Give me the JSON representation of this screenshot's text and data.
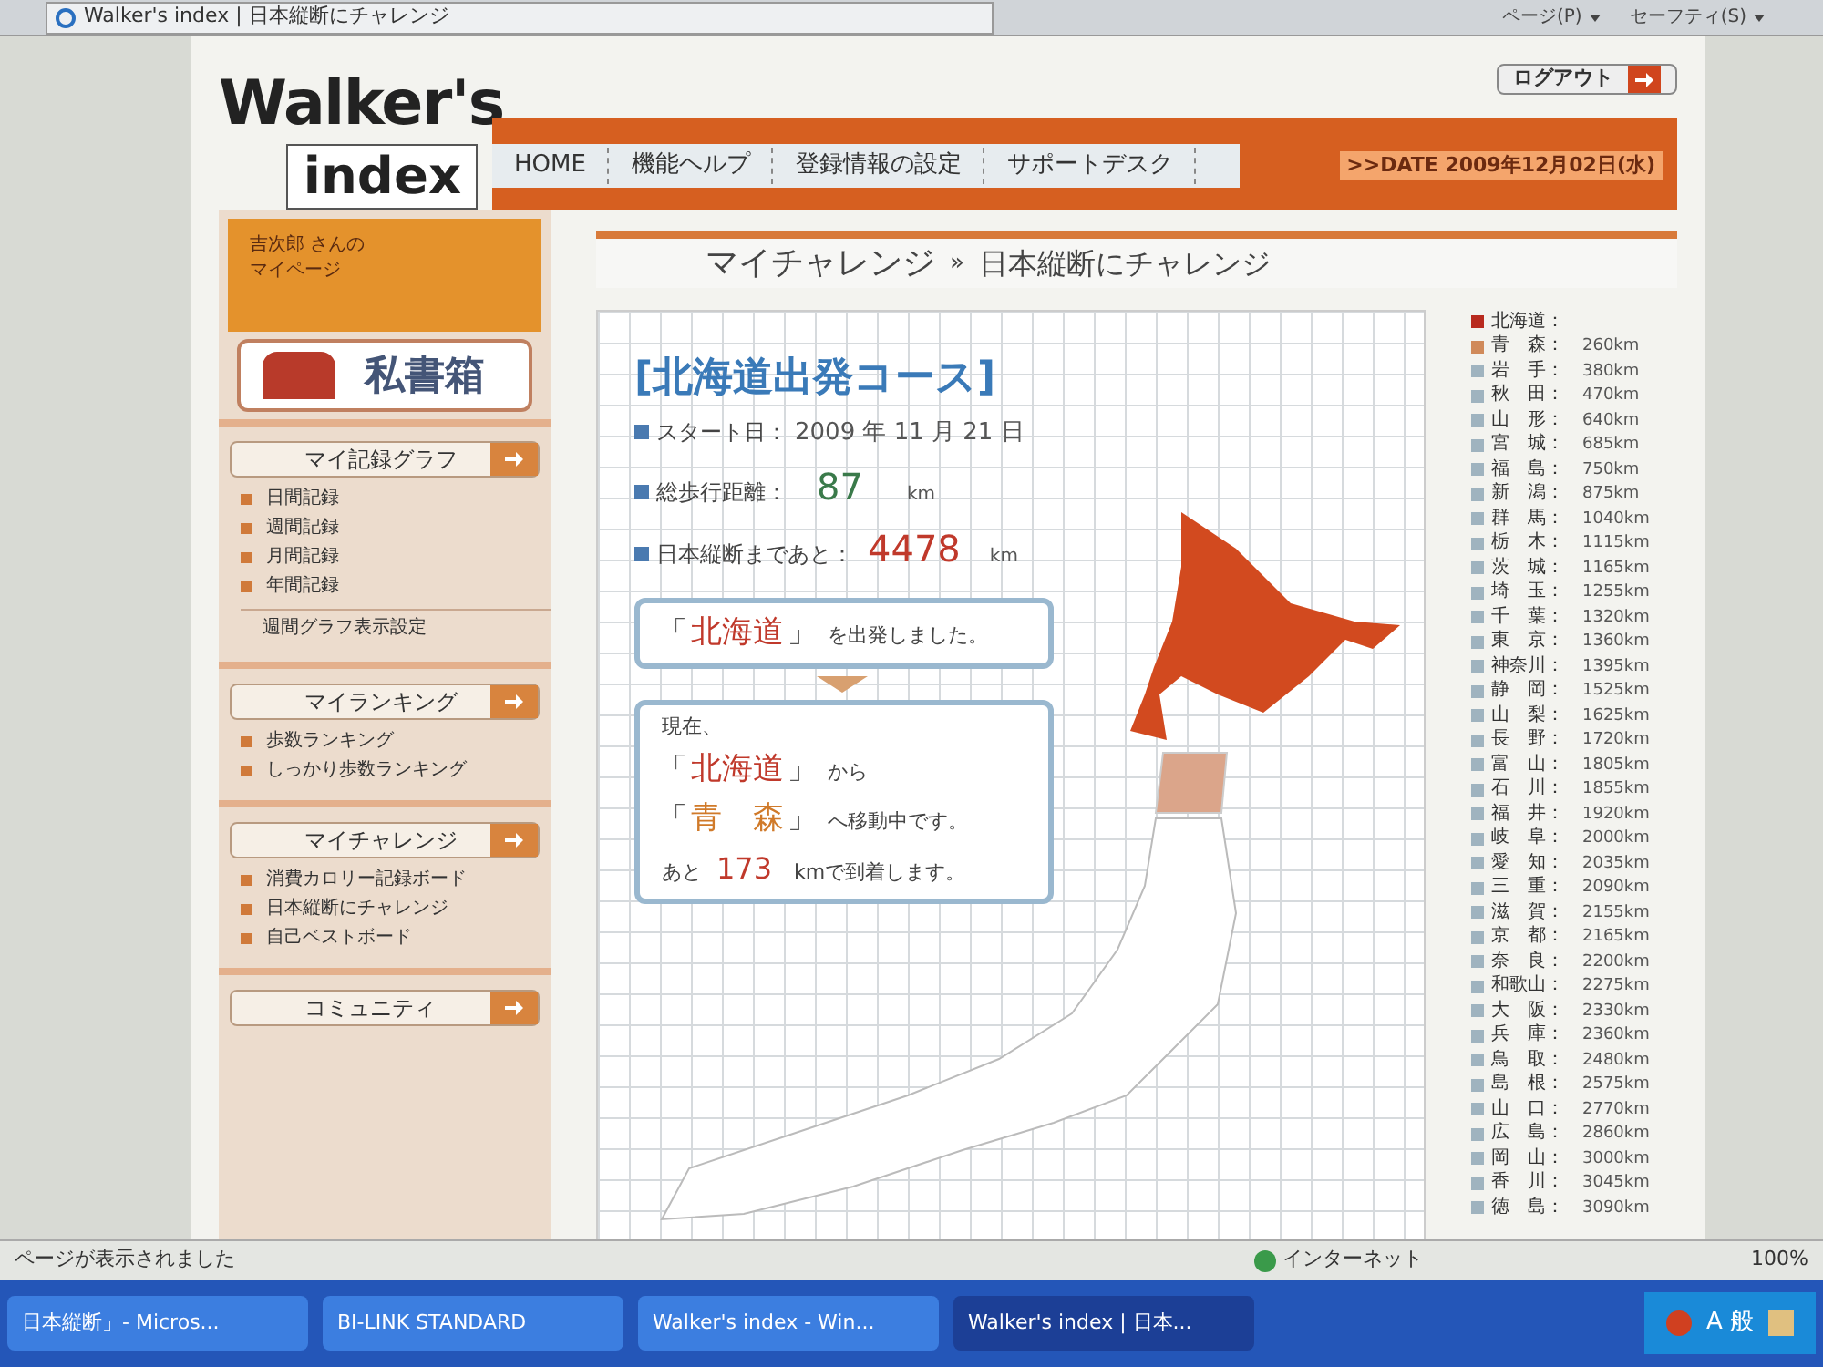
{
  "browser": {
    "tab_title": "Walker's index | 日本縦断にチャレンジ",
    "toolbar": [
      "ページ(P)",
      "セーフティ(S)"
    ]
  },
  "header": {
    "logo_top": "Walker's",
    "logo_bottom": "index",
    "logout": "ログアウト",
    "nav": [
      "HOME",
      "機能ヘルプ",
      "登録情報の設定",
      "サポートデスク"
    ],
    "date": ">>DATE 2009年12月02日(水)"
  },
  "sidebar": {
    "user_lines": [
      "吉次郎 さんの",
      "マイページ"
    ],
    "mailbox": "私書箱",
    "sections": [
      {
        "title": "マイ記録グラフ",
        "items": [
          {
            "kind": "bullet",
            "label": "日間記録"
          },
          {
            "kind": "bullet",
            "label": "週間記録"
          },
          {
            "kind": "bullet",
            "label": "月間記録"
          },
          {
            "kind": "bullet",
            "label": "年間記録"
          },
          {
            "kind": "plain",
            "label": "週間グラフ表示設定"
          }
        ]
      },
      {
        "title": "マイランキング",
        "items": [
          {
            "kind": "bullet",
            "label": "歩数ランキング"
          },
          {
            "kind": "bullet",
            "label": "しっかり歩数ランキング"
          }
        ]
      },
      {
        "title": "マイチャレンジ",
        "items": [
          {
            "kind": "bullet",
            "label": "消費カロリー記録ボード"
          },
          {
            "kind": "bullet",
            "label": "日本縦断にチャレンジ"
          },
          {
            "kind": "bullet",
            "label": "自己ベストボード"
          }
        ]
      },
      {
        "title": "コミュニティ"
      }
    ]
  },
  "breadcrumb": {
    "parent": "マイチャレンジ",
    "separator": "»",
    "current": "日本縦断にチャレンジ"
  },
  "course": {
    "title": "[北海道出発コース]",
    "stats": [
      {
        "label": "スタート日：",
        "value": "2009 年 11 月 21 日",
        "kind": "date"
      },
      {
        "label": "総歩行距離：",
        "value": "87",
        "unit": "km",
        "kind": "walked"
      },
      {
        "label": "日本縦断まであと：",
        "value": "4478",
        "unit": "km",
        "kind": "remaining"
      }
    ],
    "departed_box": [
      [
        {
          "kind": "bracket",
          "text": "「"
        },
        {
          "kind": "place",
          "text": "北海道",
          "color": "#c0392b"
        },
        {
          "kind": "bracket",
          "text": "」"
        },
        {
          "kind": "text",
          "text": "を出発しました。"
        }
      ]
    ],
    "current_box": [
      [
        {
          "kind": "text",
          "text": "現在、"
        }
      ],
      [
        {
          "kind": "bracket",
          "text": "「"
        },
        {
          "kind": "place",
          "text": "北海道",
          "color": "#c0392b"
        },
        {
          "kind": "bracket",
          "text": "」"
        },
        {
          "kind": "text",
          "text": "から"
        }
      ],
      [
        {
          "kind": "bracket",
          "text": "「"
        },
        {
          "kind": "place",
          "text": "青　森",
          "color": "#d07a2a"
        },
        {
          "kind": "bracket",
          "text": "」"
        },
        {
          "kind": "text",
          "text": "へ移動中です。"
        }
      ],
      [
        {
          "kind": "text",
          "text": "あと"
        },
        {
          "kind": "number",
          "text": "173"
        },
        {
          "kind": "text",
          "text": "kmで到着します。"
        }
      ]
    ]
  },
  "legend": [
    {
      "name": "北海道：",
      "color": "#b82a1e"
    },
    {
      "name": "青　森：",
      "distance": "260km",
      "color": "#d08a5a"
    },
    {
      "name": "岩　手：",
      "distance": "380km",
      "color": "#9fb3bf"
    },
    {
      "name": "秋　田：",
      "distance": "470km",
      "color": "#9fb3bf"
    },
    {
      "name": "山　形：",
      "distance": "640km",
      "color": "#9fb3bf"
    },
    {
      "name": "宮　城：",
      "distance": "685km",
      "color": "#9fb3bf"
    },
    {
      "name": "福　島：",
      "distance": "750km",
      "color": "#9fb3bf"
    },
    {
      "name": "新　潟：",
      "distance": "875km",
      "color": "#9fb3bf"
    },
    {
      "name": "群　馬：",
      "distance": "1040km",
      "color": "#9fb3bf"
    },
    {
      "name": "栃　木：",
      "distance": "1115km",
      "color": "#9fb3bf"
    },
    {
      "name": "茨　城：",
      "distance": "1165km",
      "color": "#9fb3bf"
    },
    {
      "name": "埼　玉：",
      "distance": "1255km",
      "color": "#9fb3bf"
    },
    {
      "name": "千　葉：",
      "distance": "1320km",
      "color": "#9fb3bf"
    },
    {
      "name": "東　京：",
      "distance": "1360km",
      "color": "#9fb3bf"
    },
    {
      "name": "神奈川：",
      "distance": "1395km",
      "color": "#9fb3bf"
    },
    {
      "name": "静　岡：",
      "distance": "1525km",
      "color": "#9fb3bf"
    },
    {
      "name": "山　梨：",
      "distance": "1625km",
      "color": "#9fb3bf"
    },
    {
      "name": "長　野：",
      "distance": "1720km",
      "color": "#9fb3bf"
    },
    {
      "name": "富　山：",
      "distance": "1805km",
      "color": "#9fb3bf"
    },
    {
      "name": "石　川：",
      "distance": "1855km",
      "color": "#9fb3bf"
    },
    {
      "name": "福　井：",
      "distance": "1920km",
      "color": "#9fb3bf"
    },
    {
      "name": "岐　阜：",
      "distance": "2000km",
      "color": "#9fb3bf"
    },
    {
      "name": "愛　知：",
      "distance": "2035km",
      "color": "#9fb3bf"
    },
    {
      "name": "三　重：",
      "distance": "2090km",
      "color": "#9fb3bf"
    },
    {
      "name": "滋　賀：",
      "distance": "2155km",
      "color": "#9fb3bf"
    },
    {
      "name": "京　都：",
      "distance": "2165km",
      "color": "#9fb3bf"
    },
    {
      "name": "奈　良：",
      "distance": "2200km",
      "color": "#9fb3bf"
    },
    {
      "name": "和歌山：",
      "distance": "2275km",
      "color": "#9fb3bf"
    },
    {
      "name": "大　阪：",
      "distance": "2330km",
      "color": "#9fb3bf"
    },
    {
      "name": "兵　庫：",
      "distance": "2360km",
      "color": "#9fb3bf"
    },
    {
      "name": "鳥　取：",
      "distance": "2480km",
      "color": "#9fb3bf"
    },
    {
      "name": "島　根：",
      "distance": "2575km",
      "color": "#9fb3bf"
    },
    {
      "name": "山　口：",
      "distance": "2770km",
      "color": "#9fb3bf"
    },
    {
      "name": "広　島：",
      "distance": "2860km",
      "color": "#9fb3bf"
    },
    {
      "name": "岡　山：",
      "distance": "3000km",
      "color": "#9fb3bf"
    },
    {
      "name": "香　川：",
      "distance": "3045km",
      "color": "#9fb3bf"
    },
    {
      "name": "徳　島：",
      "distance": "3090km",
      "color": "#9fb3bf"
    }
  ],
  "status_bar": {
    "message": "ページが表示されました",
    "zone": "インターネット",
    "zoom": "100%"
  },
  "taskbar": [
    {
      "label": "日本縦断」- Micros...",
      "selected": false
    },
    {
      "label": "BI-LINK STANDARD",
      "selected": false
    },
    {
      "label": "Walker's index - Win...",
      "selected": false
    },
    {
      "label": "Walker's index | 日本...",
      "selected": true
    }
  ],
  "tray": {
    "ime": "A 般"
  }
}
